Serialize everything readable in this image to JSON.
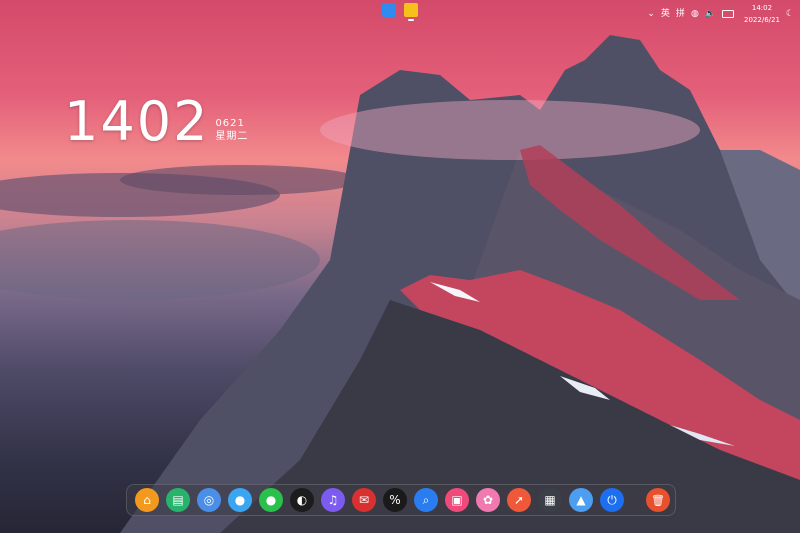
{
  "topbar": {
    "apps": [
      {
        "name": "launcher",
        "color": "#2f8bef"
      },
      {
        "name": "file-manager",
        "color": "#f5c21b"
      }
    ],
    "tray": {
      "ime_label": "英",
      "pinyin_label": "拼",
      "time": "14:02",
      "date": "2022/6/21"
    }
  },
  "widget": {
    "time": "1402",
    "date": "0621",
    "weekday": "星期二"
  },
  "dock": {
    "apps": [
      {
        "name": "home-app",
        "color": "#f39a1e",
        "glyph": "⌂"
      },
      {
        "name": "app-store",
        "color": "#27b36b",
        "glyph": "▤"
      },
      {
        "name": "browser",
        "color": "#4a8fe7",
        "glyph": "◎"
      },
      {
        "name": "penguin-app",
        "color": "#3aa6f2",
        "glyph": "●"
      },
      {
        "name": "chat-app",
        "color": "#29c04b",
        "glyph": "●"
      },
      {
        "name": "media-app",
        "color": "#1c1c1c",
        "glyph": "◐"
      },
      {
        "name": "notification-app",
        "color": "#7c5cf0",
        "glyph": "♫"
      },
      {
        "name": "mail-app",
        "color": "#d9312f",
        "glyph": "✉"
      },
      {
        "name": "percent-app",
        "color": "#1a1a1a",
        "glyph": "%"
      },
      {
        "name": "search-app",
        "color": "#2a7df0",
        "glyph": "⌕"
      },
      {
        "name": "editor-app",
        "color": "#f04a7a",
        "glyph": "▣"
      },
      {
        "name": "palette-app",
        "color": "#f07ab0",
        "glyph": "✿"
      },
      {
        "name": "rocket-app",
        "color": "#f0583a",
        "glyph": "➚"
      },
      {
        "name": "calculator-app",
        "color": "#3a3f48",
        "glyph": "▦"
      },
      {
        "name": "photos-app",
        "color": "#4b9ef0",
        "glyph": "▲"
      },
      {
        "name": "power-app",
        "color": "#1d6ff0",
        "glyph": "⏻"
      }
    ],
    "trash": {
      "name": "trash",
      "color": "#e8502e",
      "glyph": "🗑"
    }
  }
}
